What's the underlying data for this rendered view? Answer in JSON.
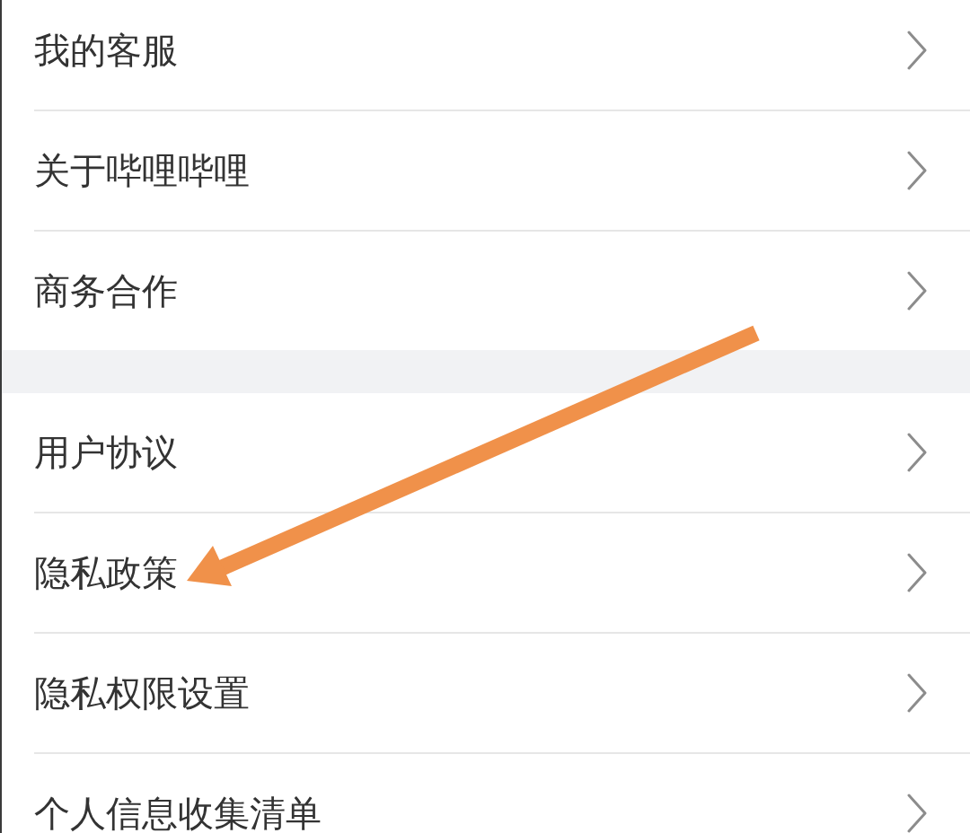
{
  "sections": [
    {
      "items": [
        {
          "label": "我的客服",
          "arrow_pointing": false
        },
        {
          "label": "关于哔哩哔哩",
          "arrow_pointing": false
        },
        {
          "label": "商务合作",
          "arrow_pointing": false
        }
      ]
    },
    {
      "items": [
        {
          "label": "用户协议",
          "arrow_pointing": false
        },
        {
          "label": "隐私政策",
          "arrow_pointing": true
        },
        {
          "label": "隐私权限设置",
          "arrow_pointing": false
        },
        {
          "label": "个人信息收集清单",
          "arrow_pointing": false
        }
      ]
    }
  ]
}
